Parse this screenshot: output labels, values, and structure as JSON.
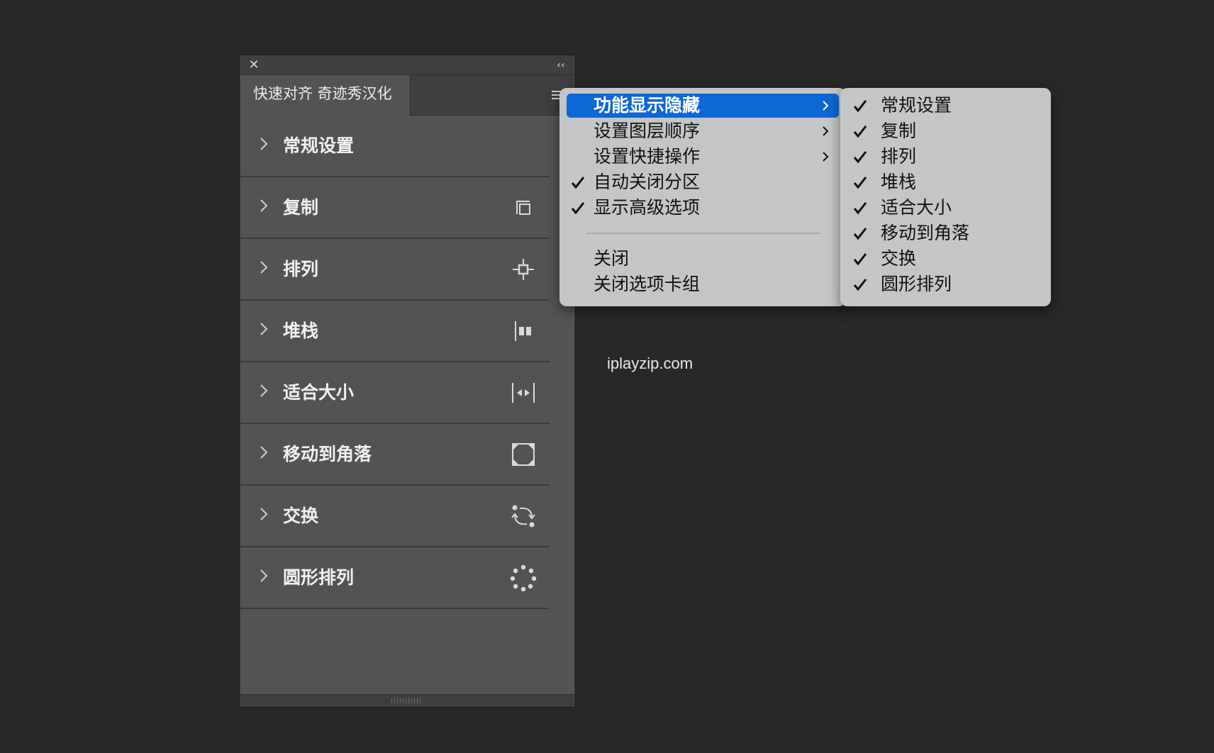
{
  "panel": {
    "tab_label": "快速对齐 奇迹秀汉化",
    "close_icon": "close-icon",
    "collapse_icon": "double-chevron-left-icon",
    "flyout_icon": "hamburger-menu-icon",
    "sections": [
      {
        "label": "常规设置",
        "icon": ""
      },
      {
        "label": "复制",
        "icon": "duplicate-icon"
      },
      {
        "label": "排列",
        "icon": "crosshair-icon"
      },
      {
        "label": "堆栈",
        "icon": "stack-icon"
      },
      {
        "label": "适合大小",
        "icon": "fit-size-icon"
      },
      {
        "label": "移动到角落",
        "icon": "corner-icon"
      },
      {
        "label": "交换",
        "icon": "swap-icon"
      },
      {
        "label": "圆形排列",
        "icon": "circle-arrange-icon"
      }
    ]
  },
  "menu": {
    "items": [
      {
        "label": "功能显示隐藏",
        "checked": false,
        "submenu": true,
        "highlighted": true
      },
      {
        "label": "设置图层顺序",
        "checked": false,
        "submenu": true
      },
      {
        "label": "设置快捷操作",
        "checked": false,
        "submenu": true
      },
      {
        "label": "自动关闭分区",
        "checked": true,
        "submenu": false
      },
      {
        "label": "显示高级选项",
        "checked": true,
        "submenu": false
      },
      {
        "label": "关闭",
        "checked": false,
        "submenu": false
      },
      {
        "label": "关闭选项卡组",
        "checked": false,
        "submenu": false
      }
    ]
  },
  "submenu": {
    "items": [
      {
        "label": "常规设置",
        "checked": true
      },
      {
        "label": "复制",
        "checked": true
      },
      {
        "label": "排列",
        "checked": true
      },
      {
        "label": "堆栈",
        "checked": true
      },
      {
        "label": "适合大小",
        "checked": true
      },
      {
        "label": "移动到角落",
        "checked": true
      },
      {
        "label": "交换",
        "checked": true
      },
      {
        "label": "圆形排列",
        "checked": true
      }
    ]
  },
  "watermark": "iplayzip.com",
  "colors": {
    "background": "#282828",
    "panel": "#535353",
    "menu": "#c4c6c6",
    "highlight": "#0d67d6"
  }
}
